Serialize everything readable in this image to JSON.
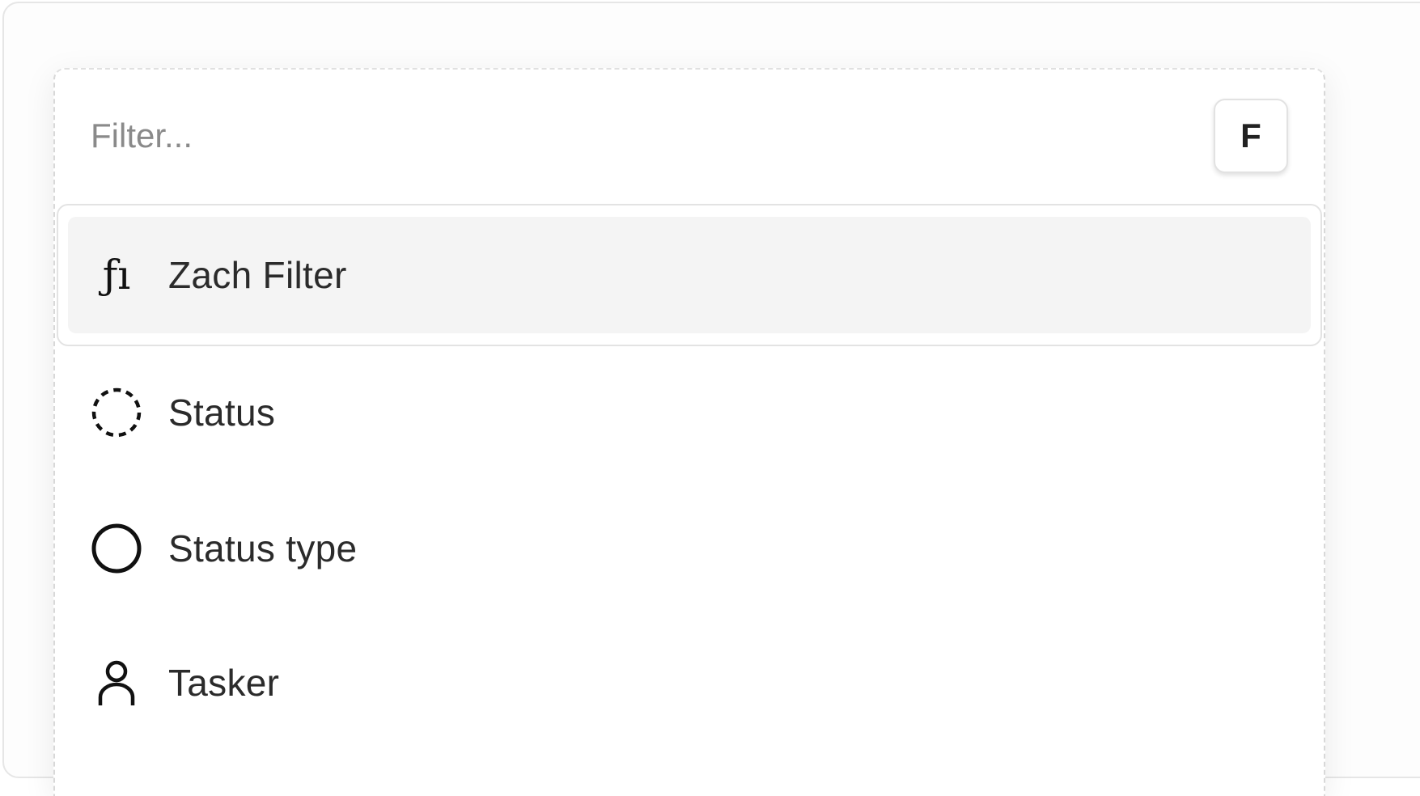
{
  "search": {
    "placeholder": "Filter...",
    "value": "",
    "shortcut_key": "F"
  },
  "items": [
    {
      "label": "Zach Filter",
      "icon": "function-icon",
      "selected": true
    },
    {
      "label": "Status",
      "icon": "dashed-circle-icon",
      "selected": false
    },
    {
      "label": "Status type",
      "icon": "circle-icon",
      "selected": false
    },
    {
      "label": "Tasker",
      "icon": "user-icon",
      "selected": false
    }
  ],
  "colors": {
    "selected_bg": "#f4f4f4",
    "text": "#2b2b2b",
    "placeholder": "#8a8a8a",
    "border": "#e3e3e3"
  }
}
